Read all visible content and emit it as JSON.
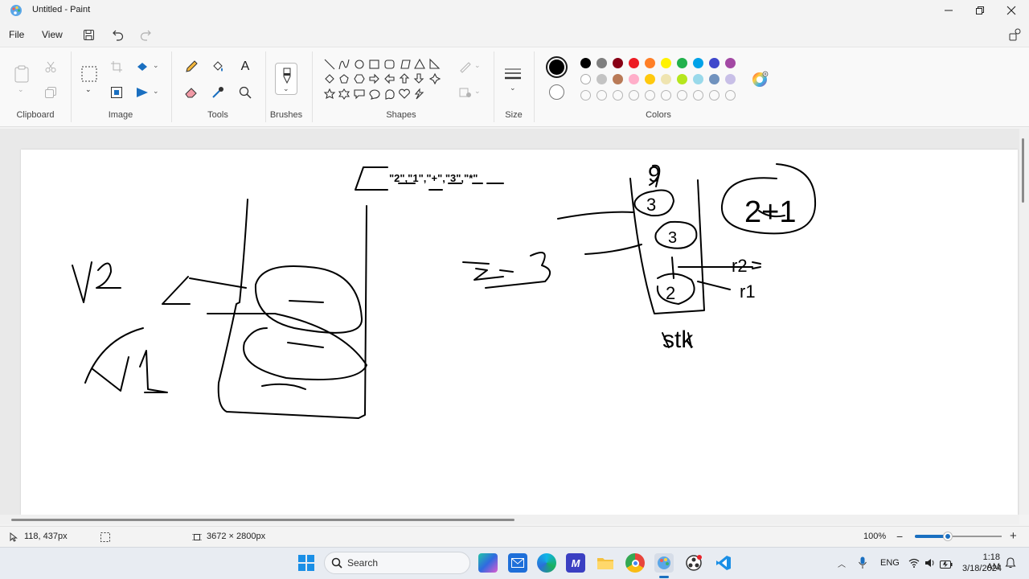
{
  "window": {
    "title": "Untitled - Paint",
    "controls": [
      "minimize",
      "restore",
      "close"
    ]
  },
  "menu": {
    "file_label": "File",
    "view_label": "View"
  },
  "ribbon": {
    "groups": {
      "clipboard": "Clipboard",
      "image": "Image",
      "tools": "Tools",
      "brushes": "Brushes",
      "shapes": "Shapes",
      "size": "Size",
      "colors": "Colors"
    },
    "current_color_primary": "#000000",
    "current_color_secondary": "#ffffff",
    "palette_row1": [
      "#000000",
      "#7f7f7f",
      "#880015",
      "#ed1c24",
      "#ff7f27",
      "#fff200",
      "#22b14c",
      "#00a2e8",
      "#3f48cc",
      "#a349a4"
    ],
    "palette_row2": [
      "#ffffff",
      "#c3c3c3",
      "#b97a57",
      "#ffaec9",
      "#ffc90e",
      "#efe4b0",
      "#b5e61d",
      "#99d9ea",
      "#7092be",
      "#c8bfe7"
    ],
    "shapes": [
      "line",
      "curve",
      "oval",
      "rectangle",
      "rounded-rectangle",
      "polygon",
      "triangle",
      "right-triangle",
      "diamond",
      "pentagon",
      "hexagon",
      "right-arrow",
      "left-arrow",
      "up-arrow",
      "down-arrow",
      "four-point-star",
      "five-point-star",
      "six-point-star",
      "rounded-callout",
      "oval-callout",
      "cloud-callout",
      "heart",
      "lightning"
    ]
  },
  "canvas": {
    "drawing_text": {
      "tokens": "\"2\",\"1\",\"+\",\"3\",\"*\"",
      "v2": "V2",
      "v1": "V1",
      "nine": "9",
      "three_arrow": "3 ⇒ 3",
      "stk": "stk",
      "r2": "r2",
      "r1": "r1",
      "two_plus_one": "2+1",
      "circled_3": "3",
      "circled_2": "2"
    }
  },
  "status": {
    "cursor_position": "118, 437px",
    "canvas_size": "3672 × 2800px",
    "zoom": "100%"
  },
  "taskbar": {
    "search_placeholder": "Search",
    "language": "ENG",
    "time": "1:18 AM",
    "date": "3/18/2024"
  }
}
